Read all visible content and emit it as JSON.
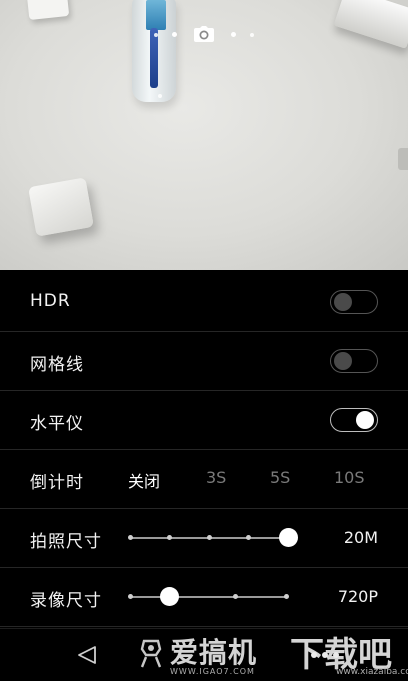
{
  "settings": {
    "hdr": {
      "label": "HDR",
      "enabled": false
    },
    "grid": {
      "label": "网格线",
      "enabled": false
    },
    "level": {
      "label": "水平仪",
      "enabled": true
    },
    "countdown": {
      "label": "倒计时",
      "options": [
        "关闭",
        "3S",
        "5S",
        "10S"
      ],
      "selected": "关闭"
    },
    "photo_size": {
      "label": "拍照尺寸",
      "value": "20M",
      "level": 1.0
    },
    "video_size": {
      "label": "录像尺寸",
      "value": "720P",
      "level": 0.25
    }
  },
  "mode_bar": {
    "current_mode_icon": "camera-icon"
  },
  "nav": {
    "back_icon": "back-triangle-icon",
    "more_icon": "more-dots-icon"
  },
  "watermark": {
    "site1": "爱搞机",
    "url1": "WWW.IGAO7.COM",
    "site2": "下载吧",
    "url2": "www.xiazaiba.com"
  }
}
